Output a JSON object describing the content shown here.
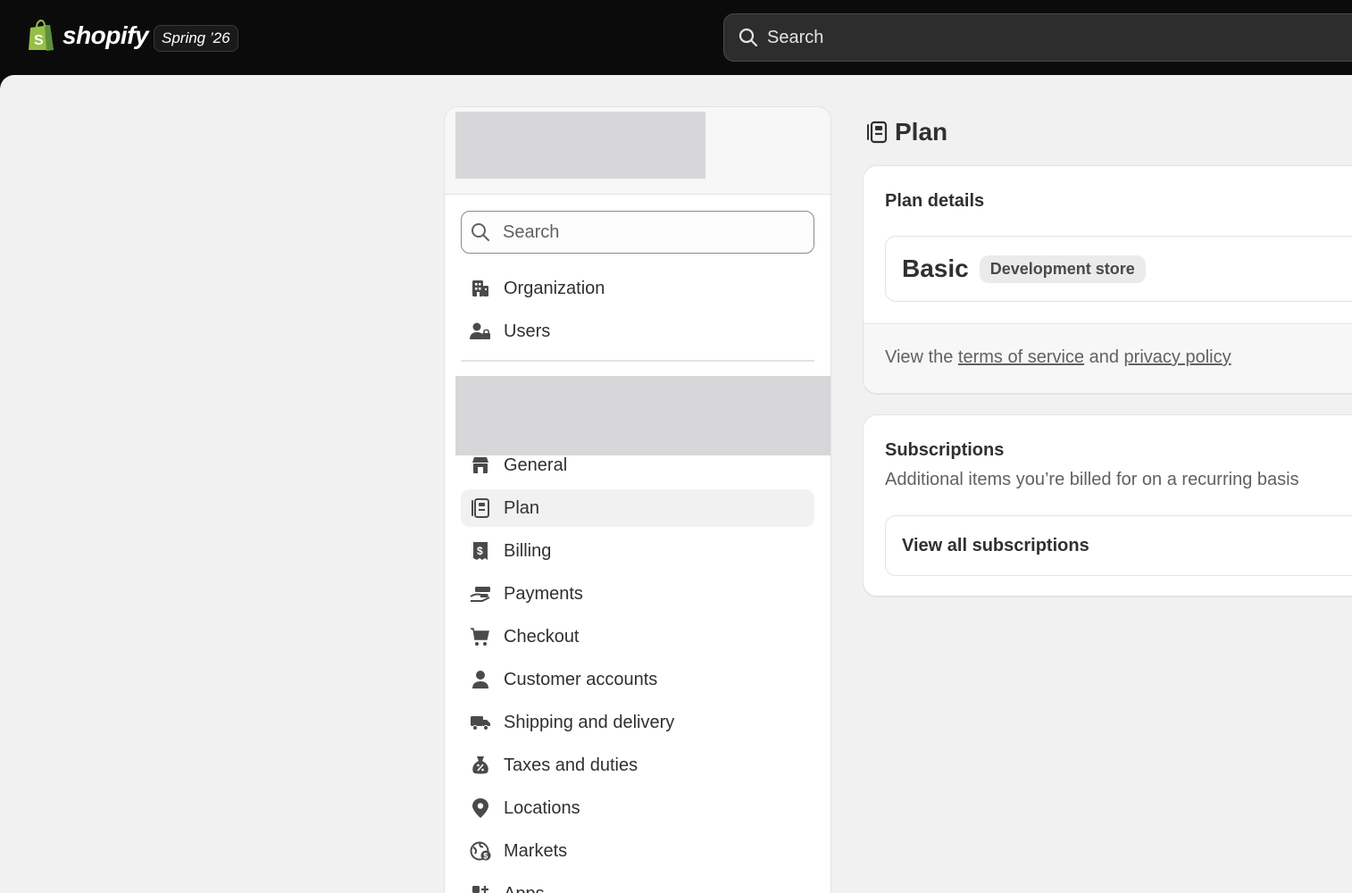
{
  "brand": {
    "name": "shopify",
    "edition": "Spring ’26",
    "colors": {
      "topbar": "#0b0b0b",
      "logo_green": "#95bf47",
      "logo_blue": "#5e8e3e"
    }
  },
  "global_search": {
    "placeholder": "Search"
  },
  "sidebar": {
    "search_placeholder": "Search",
    "top_items": [
      {
        "label": "Organization",
        "icon": "building-icon"
      },
      {
        "label": "Users",
        "icon": "users-icon"
      }
    ],
    "items": [
      {
        "label": "General",
        "icon": "store-icon"
      },
      {
        "label": "Plan",
        "icon": "plan-icon",
        "active": true
      },
      {
        "label": "Billing",
        "icon": "receipt-icon"
      },
      {
        "label": "Payments",
        "icon": "payments-icon"
      },
      {
        "label": "Checkout",
        "icon": "cart-icon"
      },
      {
        "label": "Customer accounts",
        "icon": "person-icon"
      },
      {
        "label": "Shipping and delivery",
        "icon": "truck-icon"
      },
      {
        "label": "Taxes and duties",
        "icon": "tax-bag-icon"
      },
      {
        "label": "Locations",
        "icon": "location-pin-icon"
      },
      {
        "label": "Markets",
        "icon": "globe-icon"
      },
      {
        "label": "Apps",
        "icon": "apps-icon"
      }
    ]
  },
  "main": {
    "title": "Plan",
    "plan_card": {
      "title": "Plan details",
      "plan_name": "Basic",
      "badge": "Development store",
      "footer_prefix": "View the ",
      "terms_link": "terms of service",
      "footer_mid": " and ",
      "privacy_link": "privacy policy"
    },
    "subscriptions_card": {
      "title": "Subscriptions",
      "subtitle": "Additional items you’re billed for on a recurring basis",
      "link": "View all subscriptions"
    }
  }
}
